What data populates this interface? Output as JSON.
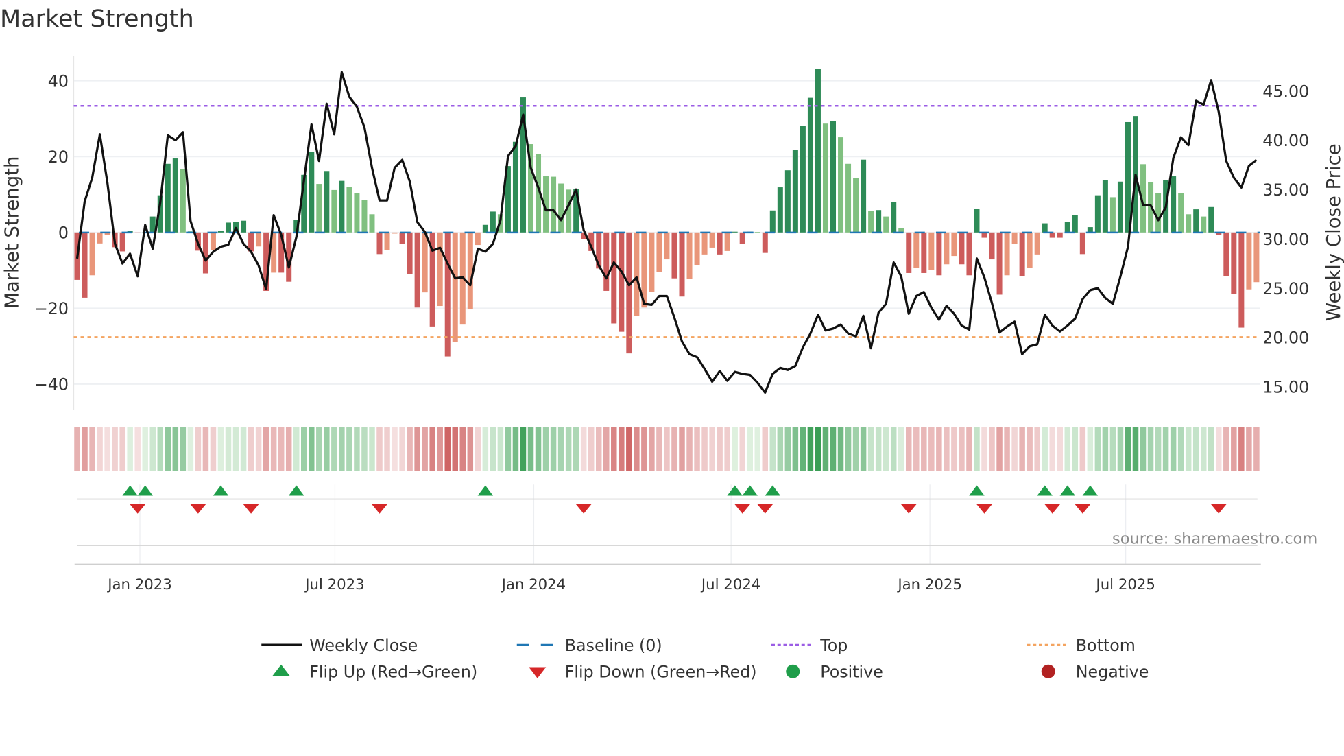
{
  "title": "Market Strength",
  "source": "source: sharemaestro.com",
  "colors": {
    "pos_rising": "#2e8b57",
    "pos_falling": "#80c080",
    "neg_falling": "#cd5c5c",
    "neg_rising": "#e9967a",
    "baseline": "#1f77b4",
    "top": "#9b5de5",
    "bottom": "#f4a460",
    "close": "#111111",
    "flip_up": "#1f9e4a",
    "flip_down": "#d62728",
    "positive": "#1f9e4a",
    "negative": "#b22222"
  },
  "chart_data": {
    "type": "bar",
    "title": "Market Strength",
    "ylabel": "Market Strength",
    "y2label": "Weekly Close Price",
    "ylim": [
      -46.8,
      46.6
    ],
    "y2lim": [
      12.65,
      48.57
    ],
    "yticks": [
      {
        "v": 40,
        "label": "40"
      },
      {
        "v": 20,
        "label": "20"
      },
      {
        "v": 0,
        "label": "0"
      },
      {
        "v": -20,
        "label": "−20"
      },
      {
        "v": -40,
        "label": "−40"
      }
    ],
    "y2ticks": [
      {
        "v": 45,
        "label": "45.00"
      },
      {
        "v": 40,
        "label": "40.00"
      },
      {
        "v": 35,
        "label": "35.00"
      },
      {
        "v": 30,
        "label": "30.00"
      },
      {
        "v": 25,
        "label": "25.00"
      },
      {
        "v": 20,
        "label": "20.00"
      },
      {
        "v": 15,
        "label": "15.00"
      }
    ],
    "xticks": [
      {
        "week": 8.3,
        "label": "Jan 2023"
      },
      {
        "week": 34.1,
        "label": "Jul 2023"
      },
      {
        "week": 60.4,
        "label": "Jan 2024"
      },
      {
        "week": 86.5,
        "label": "Jul 2024"
      },
      {
        "week": 112.8,
        "label": "Jan 2025"
      },
      {
        "week": 138.7,
        "label": "Jul 2025"
      }
    ],
    "top_level": 33.4,
    "bottom_level": -27.6,
    "baseline": 0,
    "strength": [
      -12.5,
      -17.2,
      -11.3,
      -2.9,
      -0.6,
      -3.9,
      -5,
      0.4,
      -0.2,
      0.1,
      4.2,
      9.8,
      18.1,
      19.5,
      16.7,
      0.3,
      -4.8,
      -10.8,
      -4.7,
      0.5,
      2.6,
      2.8,
      3.1,
      -5,
      -3.7,
      -15.4,
      -10.6,
      -10.6,
      -13,
      3.3,
      15.2,
      21.2,
      12.8,
      16.2,
      11.2,
      13.6,
      12,
      10.3,
      8.5,
      4.8,
      -5.7,
      -4.7,
      -0.3,
      -3,
      -11,
      -19.8,
      -15.8,
      -24.8,
      -19.4,
      -32.7,
      -28.8,
      -24.3,
      -20.3,
      -3.3,
      2,
      5.5,
      4.8,
      17.5,
      23.9,
      35.6,
      23.3,
      20.6,
      14.8,
      14.7,
      12.9,
      11.3,
      11.4,
      -1.7,
      -4.9,
      -9.5,
      -15.4,
      -24,
      -26.2,
      -31.9,
      -22,
      -19.8,
      -15.6,
      -10.5,
      -7.1,
      -12.1,
      -16.9,
      -12.2,
      -8.6,
      -5.8,
      -4,
      -5.8,
      -4.9,
      0.2,
      -3.1,
      0.2,
      0.1,
      -5.4,
      5.8,
      11.9,
      16.4,
      21.8,
      28.1,
      35.5,
      43.1,
      28.7,
      29.4,
      25.1,
      18.1,
      14.4,
      19.2,
      5.7,
      5.9,
      4.2,
      8,
      1.2,
      -10.7,
      -9.4,
      -10.7,
      -9.8,
      -11.3,
      -8.4,
      -6.2,
      -8.4,
      -11.3,
      6.2,
      -1.4,
      -7.1,
      -16.4,
      -11.3,
      -3,
      -11.6,
      -9.4,
      -5.8,
      2.4,
      -1.4,
      -1.4,
      2.7,
      4.5,
      -5.7,
      1.4,
      9.8,
      13.8,
      9.3,
      13.4,
      29.1,
      30.7,
      18,
      13.3,
      10.3,
      13.8,
      14.8,
      10.4,
      4.8,
      6.1,
      4.2,
      6.7,
      -0.7,
      -11.6,
      -16.3,
      -25.1,
      -15,
      -13.1
    ],
    "close": [
      28.0,
      33.8,
      36.2,
      40.6,
      35.7,
      29.5,
      27.5,
      28.5,
      26.2,
      31.4,
      29.0,
      33.7,
      40.5,
      40.0,
      40.8,
      31.8,
      29.5,
      27.8,
      28.7,
      29.2,
      29.4,
      31.1,
      29.5,
      28.7,
      27.3,
      24.9,
      32.4,
      30.4,
      27.1,
      30.2,
      35.9,
      41.6,
      37.9,
      43.7,
      40.6,
      46.9,
      44.4,
      43.4,
      41.3,
      37.2,
      33.9,
      33.9,
      37.2,
      38.0,
      35.8,
      31.7,
      30.7,
      28.8,
      29.1,
      27.5,
      26.0,
      26.1,
      25.3,
      29.0,
      28.7,
      29.5,
      31.9,
      38.4,
      39.4,
      42.6,
      37.2,
      35.2,
      32.9,
      32.9,
      31.9,
      33.4,
      35.0,
      30.9,
      29.2,
      27.3,
      26.0,
      27.6,
      26.7,
      25.3,
      26.1,
      23.4,
      23.3,
      24.2,
      24.2,
      22.0,
      19.6,
      18.3,
      18.0,
      16.8,
      15.5,
      16.6,
      15.6,
      16.5,
      16.3,
      16.2,
      15.4,
      14.4,
      16.3,
      16.9,
      16.7,
      17.1,
      19.0,
      20.4,
      22.3,
      20.7,
      20.9,
      21.3,
      20.4,
      20.1,
      22.2,
      18.9,
      22.5,
      23.4,
      27.6,
      26.2,
      22.4,
      24.2,
      24.6,
      23.0,
      21.8,
      23.2,
      22.4,
      21.2,
      20.8,
      28.0,
      26.1,
      23.5,
      20.5,
      21.1,
      21.6,
      18.3,
      19.1,
      19.3,
      22.3,
      21.2,
      20.6,
      21.2,
      21.9,
      23.9,
      24.8,
      25.0,
      24.0,
      23.4,
      26.2,
      29.2,
      36.5,
      33.4,
      33.4,
      31.9,
      33.2,
      38.2,
      40.3,
      39.5,
      44.0,
      43.6,
      46.1,
      42.9,
      37.9,
      36.2,
      35.2,
      37.4,
      38.0
    ],
    "flip_up_weeks": [
      7,
      9,
      19,
      29,
      54,
      87,
      89,
      92,
      119,
      128,
      131,
      134
    ],
    "flip_down_weeks": [
      8,
      16,
      23,
      40,
      67,
      88,
      91,
      110,
      120,
      129,
      133,
      151
    ],
    "legend": {
      "placement": "bottom",
      "weekly_close": "Weekly Close",
      "baseline": "Baseline (0)",
      "top": "Top",
      "bottom": "Bottom",
      "flip_up": "Flip Up (Red→Green)",
      "flip_down": "Flip Down (Green→Red)",
      "positive": "Positive",
      "negative": "Negative"
    }
  }
}
